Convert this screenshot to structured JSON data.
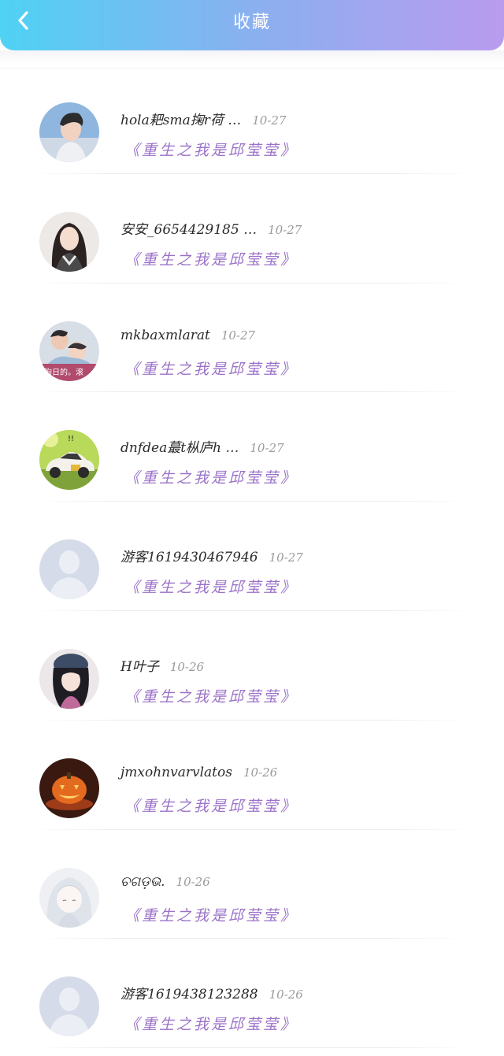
{
  "header": {
    "title": "收藏",
    "gradient_start": "#4fd2f4",
    "gradient_end": "#b99bee"
  },
  "items": [
    {
      "username": "hola耙sma掬r荷 …",
      "date": "10-27",
      "book": "《重生之我是邱莹莹》",
      "avatar": "boy-photo"
    },
    {
      "username": "安安_6654429185 …",
      "date": "10-27",
      "book": "《重生之我是邱莹莹》",
      "avatar": "girl-photo"
    },
    {
      "username": "mkbaxmlarat",
      "date": "10-27",
      "book": "《重生之我是邱莹莹》",
      "avatar": "couple-photo"
    },
    {
      "username": "dnfdea蕞t枞庐h …",
      "date": "10-27",
      "book": "《重生之我是邱莹莹》",
      "avatar": "car-toy"
    },
    {
      "username": "游客1619430467946",
      "date": "10-27",
      "book": "《重生之我是邱莹莹》",
      "avatar": "default-avatar"
    },
    {
      "username": "H叶子",
      "date": "10-26",
      "book": "《重生之我是邱莹莹》",
      "avatar": "anime-girl"
    },
    {
      "username": "jmxohnvarvlatos",
      "date": "10-26",
      "book": "《重生之我是邱莹莹》",
      "avatar": "pumpkin"
    },
    {
      "username": "ଚଗଡ଼ଭ.",
      "date": "10-26",
      "book": "《重生之我是邱莹莹》",
      "avatar": "anime-white"
    },
    {
      "username": "游客1619438123288",
      "date": "10-26",
      "book": "《重生之我是邱莹莹》",
      "avatar": "default-avatar"
    }
  ]
}
